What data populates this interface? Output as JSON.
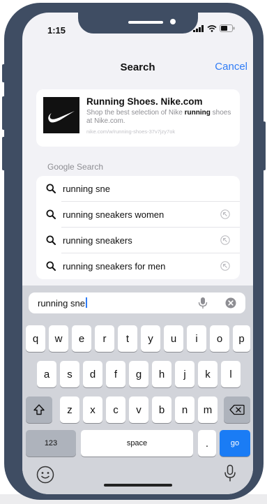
{
  "status": {
    "time": "1:15"
  },
  "header": {
    "title": "Search",
    "cancel_label": "Cancel"
  },
  "suggestion_card": {
    "title": "Running Shoes. Nike.com",
    "desc_before": "Shop the best selection of Nike ",
    "desc_bold": "running",
    "desc_after": " shoes at Nike.com.",
    "url": "nike.com/w/running-shoes-37v7jzy7ok"
  },
  "google_search": {
    "section_label": "Google Search",
    "items": [
      {
        "label": "running sne",
        "fill_icon": false
      },
      {
        "label": "running sneakers women",
        "fill_icon": true
      },
      {
        "label": "running sneakers",
        "fill_icon": true
      },
      {
        "label": "running sneakers for men",
        "fill_icon": true
      }
    ]
  },
  "search_field": {
    "value": "running sne"
  },
  "keyboard": {
    "row1": [
      "q",
      "w",
      "e",
      "r",
      "t",
      "y",
      "u",
      "i",
      "o",
      "p"
    ],
    "row2": [
      "a",
      "s",
      "d",
      "f",
      "g",
      "h",
      "j",
      "k",
      "l"
    ],
    "row3": [
      "z",
      "x",
      "c",
      "v",
      "b",
      "n",
      "m"
    ],
    "numbers_label": "123",
    "space_label": "space",
    "period_label": ".",
    "go_label": "go"
  },
  "colors": {
    "accent": "#2f7cf6",
    "go_key": "#1a7cf5",
    "frame": "#3f4d63"
  }
}
